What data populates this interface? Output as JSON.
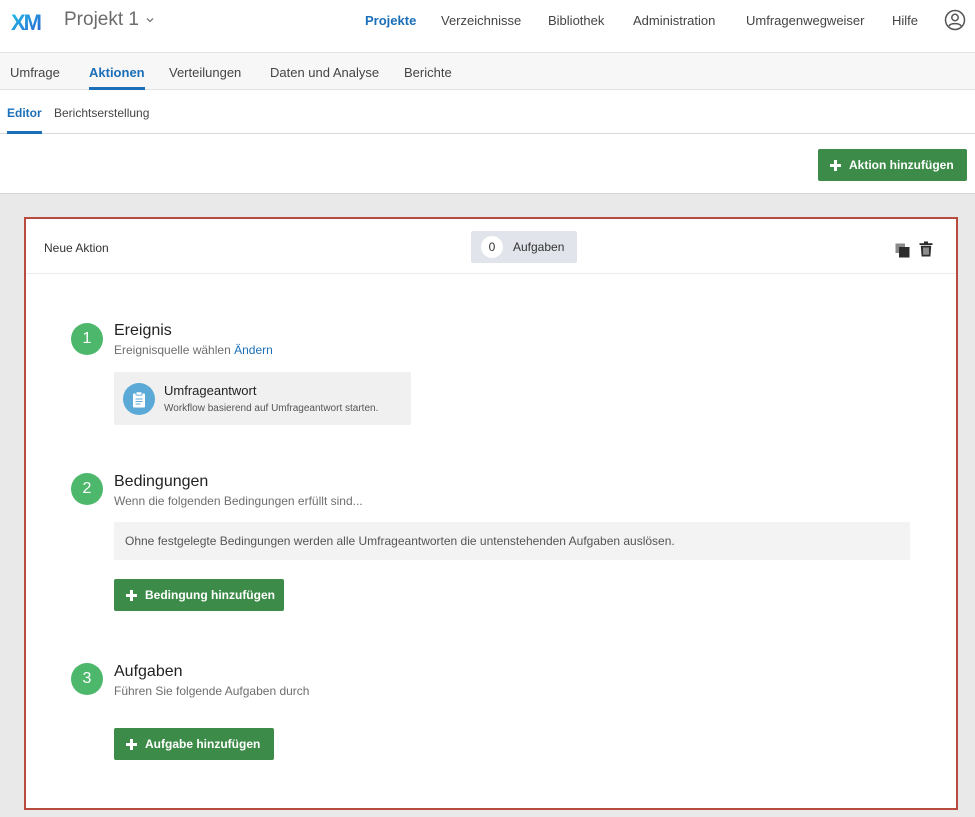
{
  "header": {
    "logo_text": "XM",
    "project_title": "Projekt 1",
    "nav": [
      {
        "label": "Projekte",
        "active": true
      },
      {
        "label": "Verzeichnisse",
        "active": false
      },
      {
        "label": "Bibliothek",
        "active": false
      },
      {
        "label": "Administration",
        "active": false
      },
      {
        "label": "Umfragenwegweiser",
        "active": false
      },
      {
        "label": "Hilfe",
        "active": false
      }
    ],
    "user_icon": "user-circle-icon"
  },
  "tabs": [
    {
      "label": "Umfrage",
      "active": false
    },
    {
      "label": "Aktionen",
      "active": true
    },
    {
      "label": "Verteilungen",
      "active": false
    },
    {
      "label": "Daten und Analyse",
      "active": false
    },
    {
      "label": "Berichte",
      "active": false
    }
  ],
  "subtabs": [
    {
      "label": "Editor",
      "active": true
    },
    {
      "label": "Berichtserstellung",
      "active": false
    }
  ],
  "toolbar": {
    "add_action_label": "Aktion hinzufügen"
  },
  "action_card": {
    "name": "Neue Aktion",
    "task_count": "0",
    "task_count_label": "Aufgaben",
    "steps": {
      "event": {
        "number": "1",
        "title": "Ereignis",
        "subtitle": "Ereignisquelle wählen",
        "change_link": "Ändern",
        "source": {
          "title": "Umfrageantwort",
          "description": "Workflow basierend auf Umfrageantwort starten.",
          "icon": "clipboard-icon"
        }
      },
      "conditions": {
        "number": "2",
        "title": "Bedingungen",
        "subtitle": "Wenn die folgenden Bedingungen erfüllt sind...",
        "info": "Ohne festgelegte Bedingungen werden alle Umfrageantworten die untenstehenden Aufgaben auslösen.",
        "add_label": "Bedingung hinzufügen"
      },
      "tasks": {
        "number": "3",
        "title": "Aufgaben",
        "subtitle": "Führen Sie folgende Aufgaben durch",
        "add_label": "Aufgabe hinzufügen"
      }
    }
  },
  "colors": {
    "accent_blue": "#1a6fb8",
    "green_button": "#3d8b48",
    "step_green": "#4db86c",
    "card_border": "#b94a3e"
  }
}
